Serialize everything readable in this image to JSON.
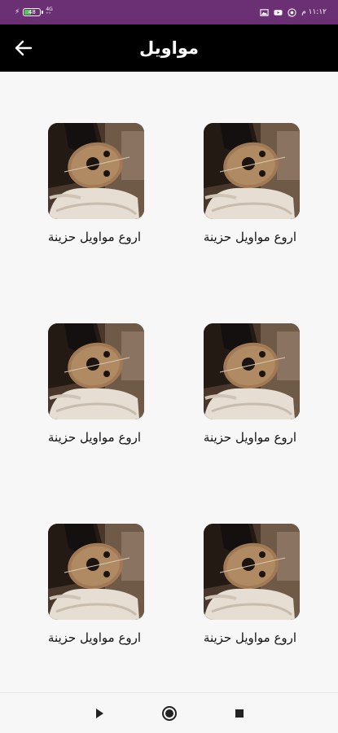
{
  "status_bar": {
    "charge_symbol": "⚡",
    "battery_level": "48",
    "signal_top": "4G",
    "signal_bottom": "⁺⁺",
    "time": "١١:١٢ م",
    "battery_percent": 48,
    "icons": [
      "whatsapp-icon",
      "youtube-icon",
      "gallery-icon"
    ]
  },
  "app_bar": {
    "title": "مواويل",
    "back_icon": "arrow-left-icon"
  },
  "items": [
    {
      "label": "اروع مواويل حزينة",
      "image": "oud-player-image"
    },
    {
      "label": "اروع مواويل حزينة",
      "image": "oud-player-image"
    },
    {
      "label": "اروع مواويل حزينة",
      "image": "oud-player-image"
    },
    {
      "label": "اروع مواويل حزينة",
      "image": "oud-player-image"
    },
    {
      "label": "اروع مواويل حزينة",
      "image": "oud-player-image"
    },
    {
      "label": "اروع مواويل حزينة",
      "image": "oud-player-image"
    }
  ],
  "nav_bar": {
    "buttons": [
      "back-triangle-icon",
      "home-circle-icon",
      "recents-square-icon"
    ]
  },
  "colors": {
    "status_bar_bg": "#6b2f73",
    "app_bar_bg": "#000000",
    "page_bg": "#f7f7f7",
    "battery_fill": "#58c65c"
  }
}
